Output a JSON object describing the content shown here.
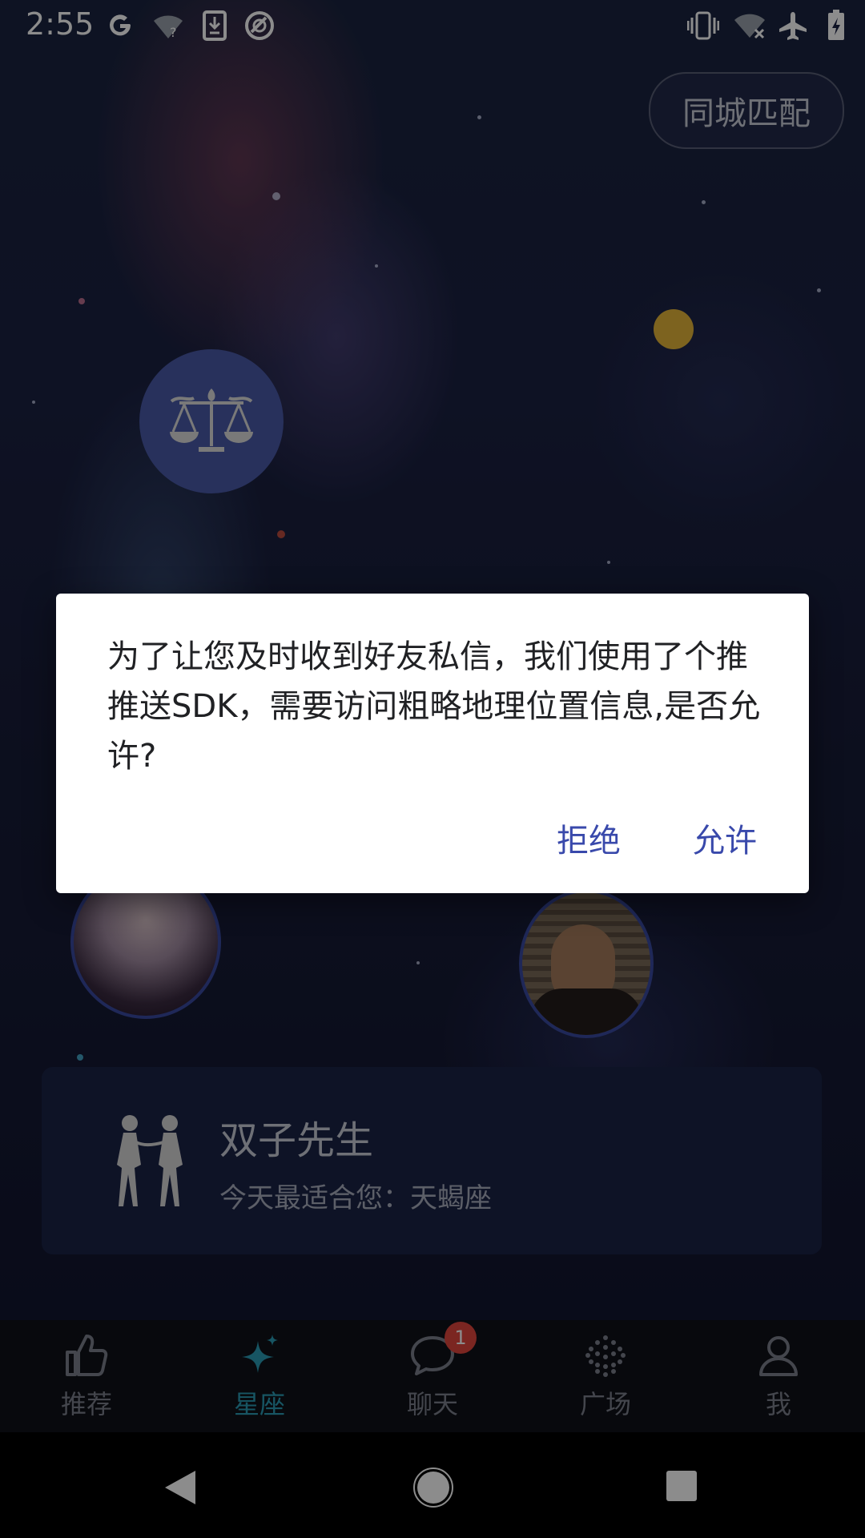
{
  "status_bar": {
    "time": "2:55",
    "left_icons": [
      "google-icon",
      "wifi-unknown-icon",
      "download-icon",
      "sync-icon"
    ],
    "right_icons": [
      "vibrate-icon",
      "wifi-off-icon",
      "airplane-icon",
      "battery-charging-icon"
    ]
  },
  "header": {
    "city_match_label": "同城匹配"
  },
  "zodiac_card": {
    "name": "双子先生",
    "match_text": "今天最适合您：天蝎座"
  },
  "tabs": [
    {
      "label": "推荐",
      "icon": "thumbs-up-icon",
      "active": false
    },
    {
      "label": "星座",
      "icon": "sparkle-icon",
      "active": true
    },
    {
      "label": "聊天",
      "icon": "chat-bubble-icon",
      "active": false,
      "badge": "1"
    },
    {
      "label": "广场",
      "icon": "dots-grid-icon",
      "active": false
    },
    {
      "label": "我",
      "icon": "person-icon",
      "active": false
    }
  ],
  "dialog": {
    "message": "为了让您及时收到好友私信，我们使用了个推推送SDK，需要访问粗略地理位置信息,是否允许?",
    "deny_label": "拒绝",
    "allow_label": "允许"
  },
  "colors": {
    "accent": "#2a9bb5",
    "dialog_button": "#3949ab",
    "badge": "#e0463d",
    "card_bg": "#1a2346"
  }
}
